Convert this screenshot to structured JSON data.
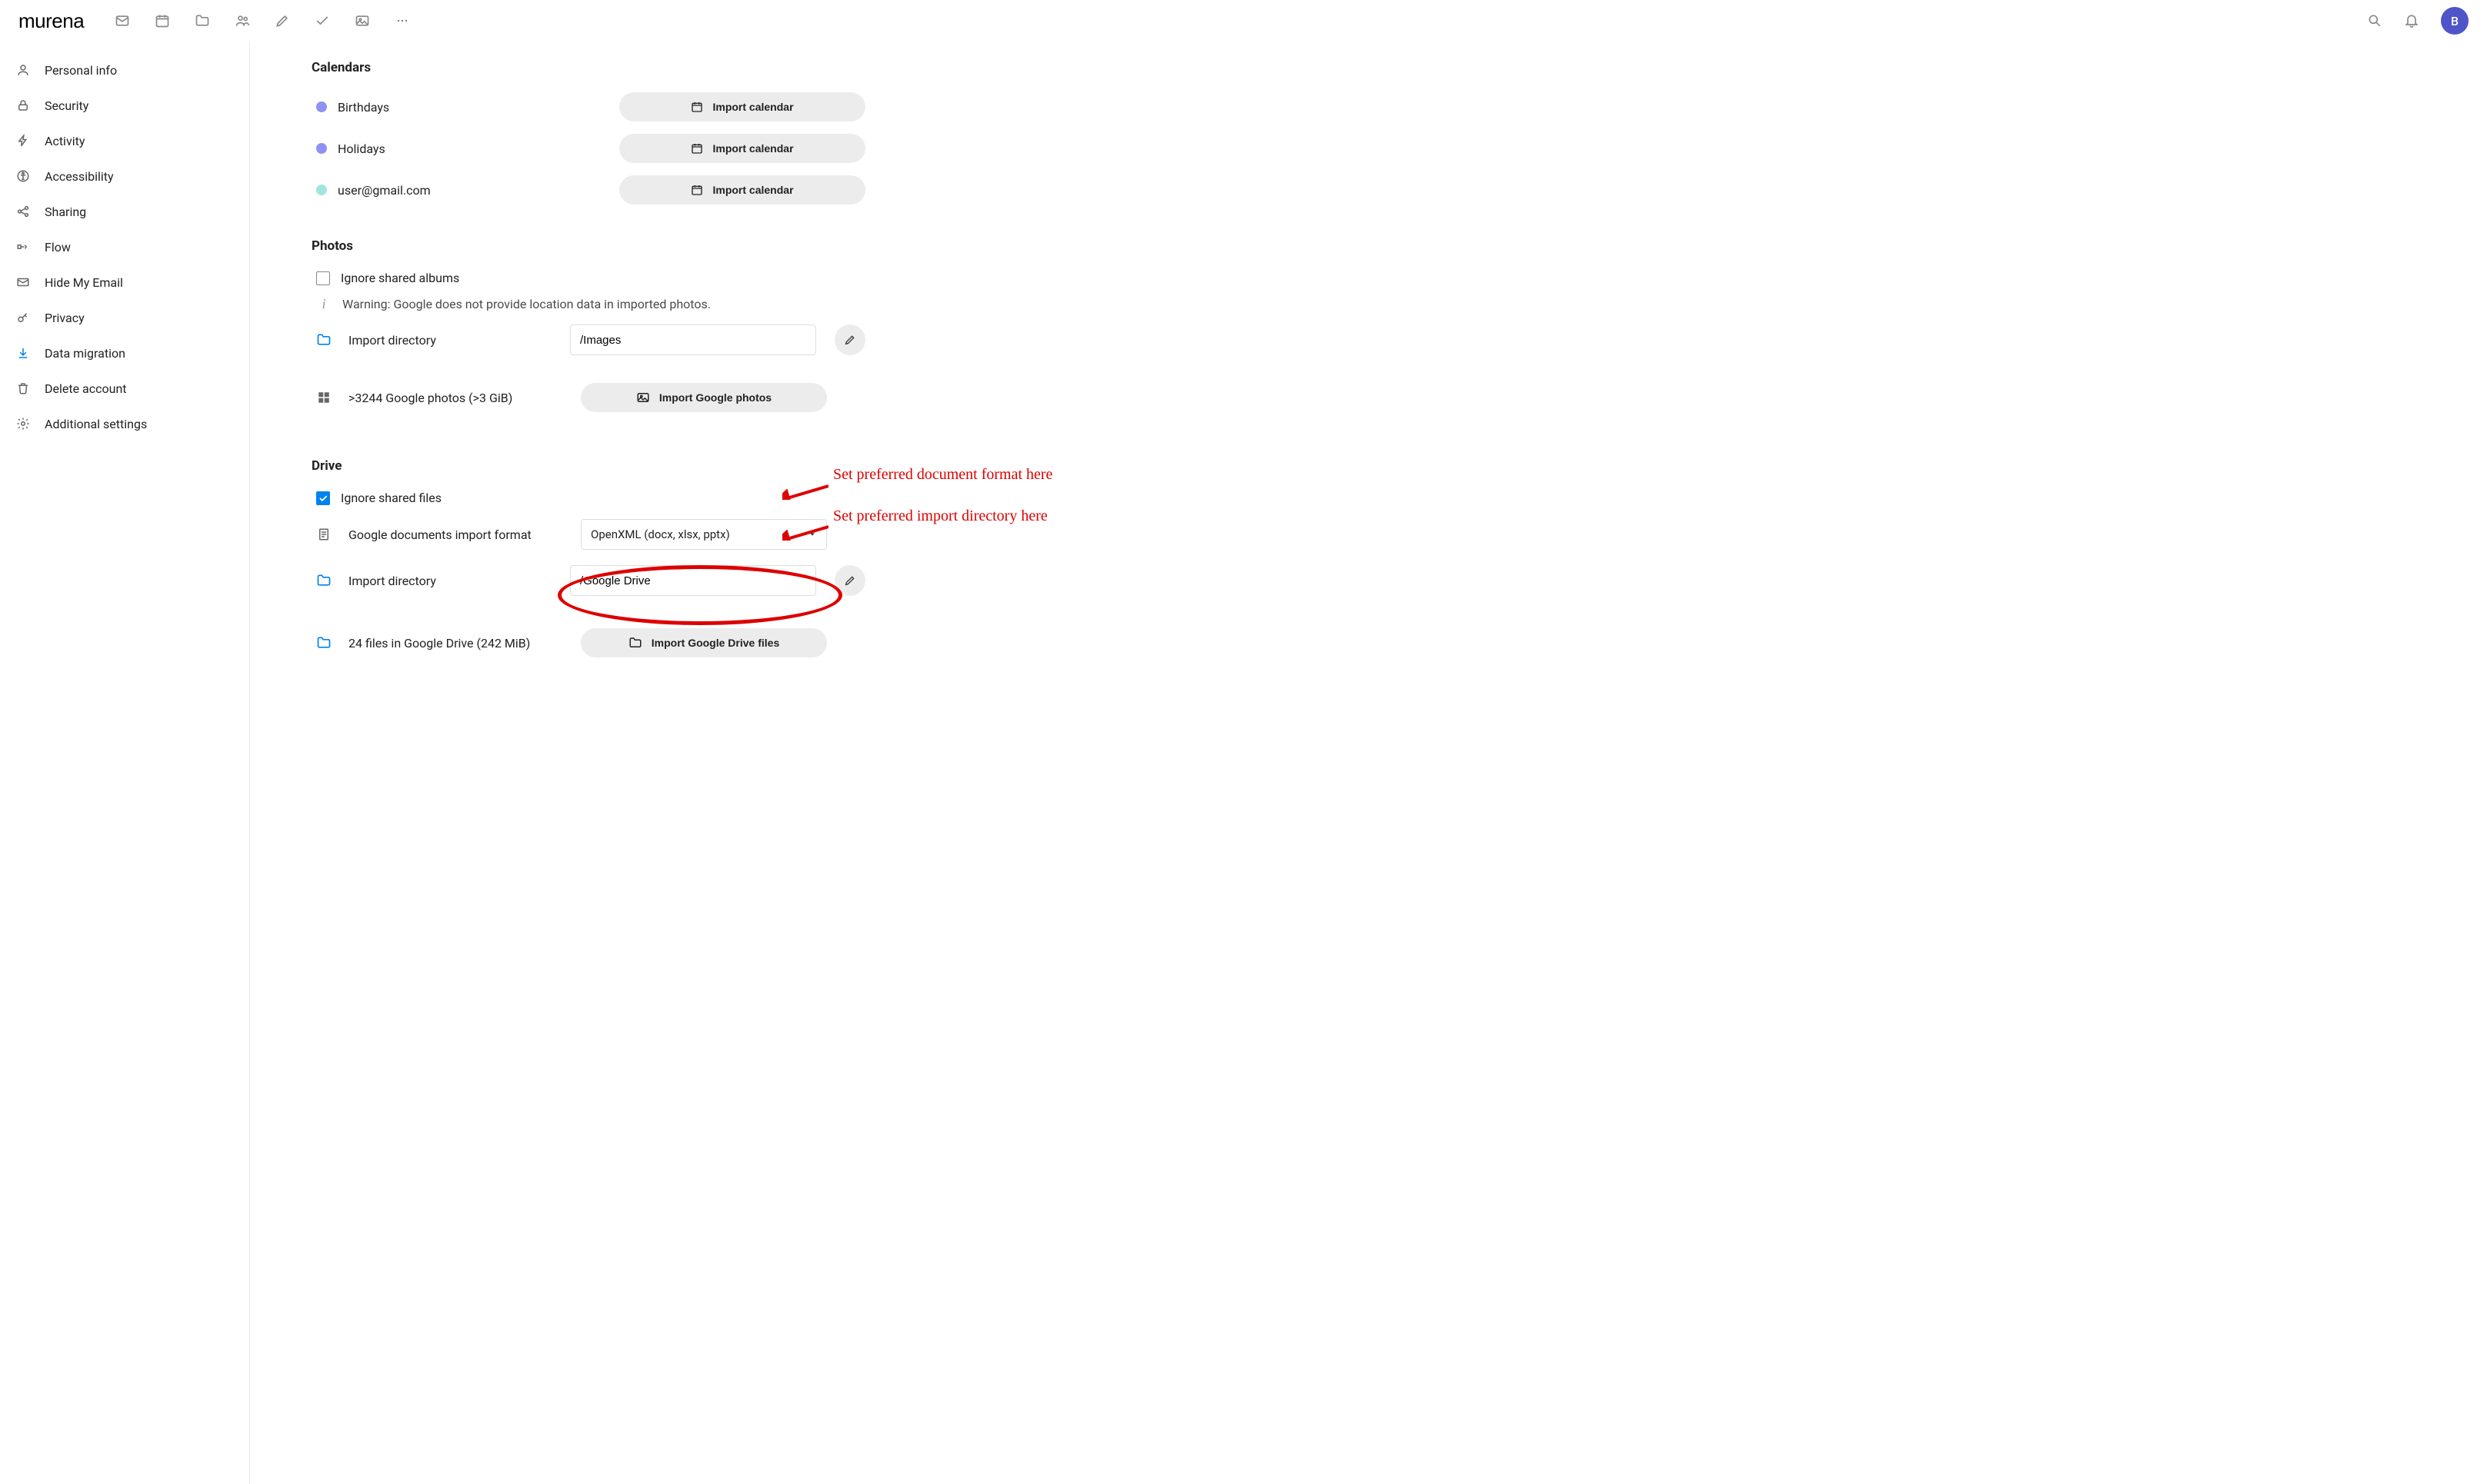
{
  "brand": "murena",
  "avatar_initial": "B",
  "sidebar": {
    "items": [
      {
        "label": "Personal info"
      },
      {
        "label": "Security"
      },
      {
        "label": "Activity"
      },
      {
        "label": "Accessibility"
      },
      {
        "label": "Sharing"
      },
      {
        "label": "Flow"
      },
      {
        "label": "Hide My Email"
      },
      {
        "label": "Privacy"
      },
      {
        "label": "Data migration"
      },
      {
        "label": "Delete account"
      },
      {
        "label": "Additional settings"
      }
    ]
  },
  "calendars": {
    "title": "Calendars",
    "items": [
      {
        "name": "Birthdays",
        "color": "#8e93f2",
        "btn": "Import calendar"
      },
      {
        "name": "Holidays",
        "color": "#8e93f2",
        "btn": "Import calendar"
      },
      {
        "name": "user@gmail.com",
        "color": "#a1e5e0",
        "btn": "Import calendar"
      }
    ]
  },
  "photos": {
    "title": "Photos",
    "ignore_label": "Ignore shared albums",
    "warning": "Warning: Google does not provide location data in imported photos.",
    "import_dir_label": "Import directory",
    "import_dir_value": "/Images",
    "count_label": ">3244 Google photos (>3 GiB)",
    "import_btn": "Import Google photos"
  },
  "drive": {
    "title": "Drive",
    "ignore_label": "Ignore shared files",
    "format_label": "Google documents import format",
    "format_value": "OpenXML (docx, xlsx, pptx)",
    "import_dir_label": "Import directory",
    "import_dir_value": "/Google Drive",
    "count_label": "24 files in Google Drive (242 MiB)",
    "import_btn": "Import Google Drive files"
  },
  "annotations": {
    "format": "Set preferred document format here",
    "directory": "Set preferred import directory here"
  }
}
